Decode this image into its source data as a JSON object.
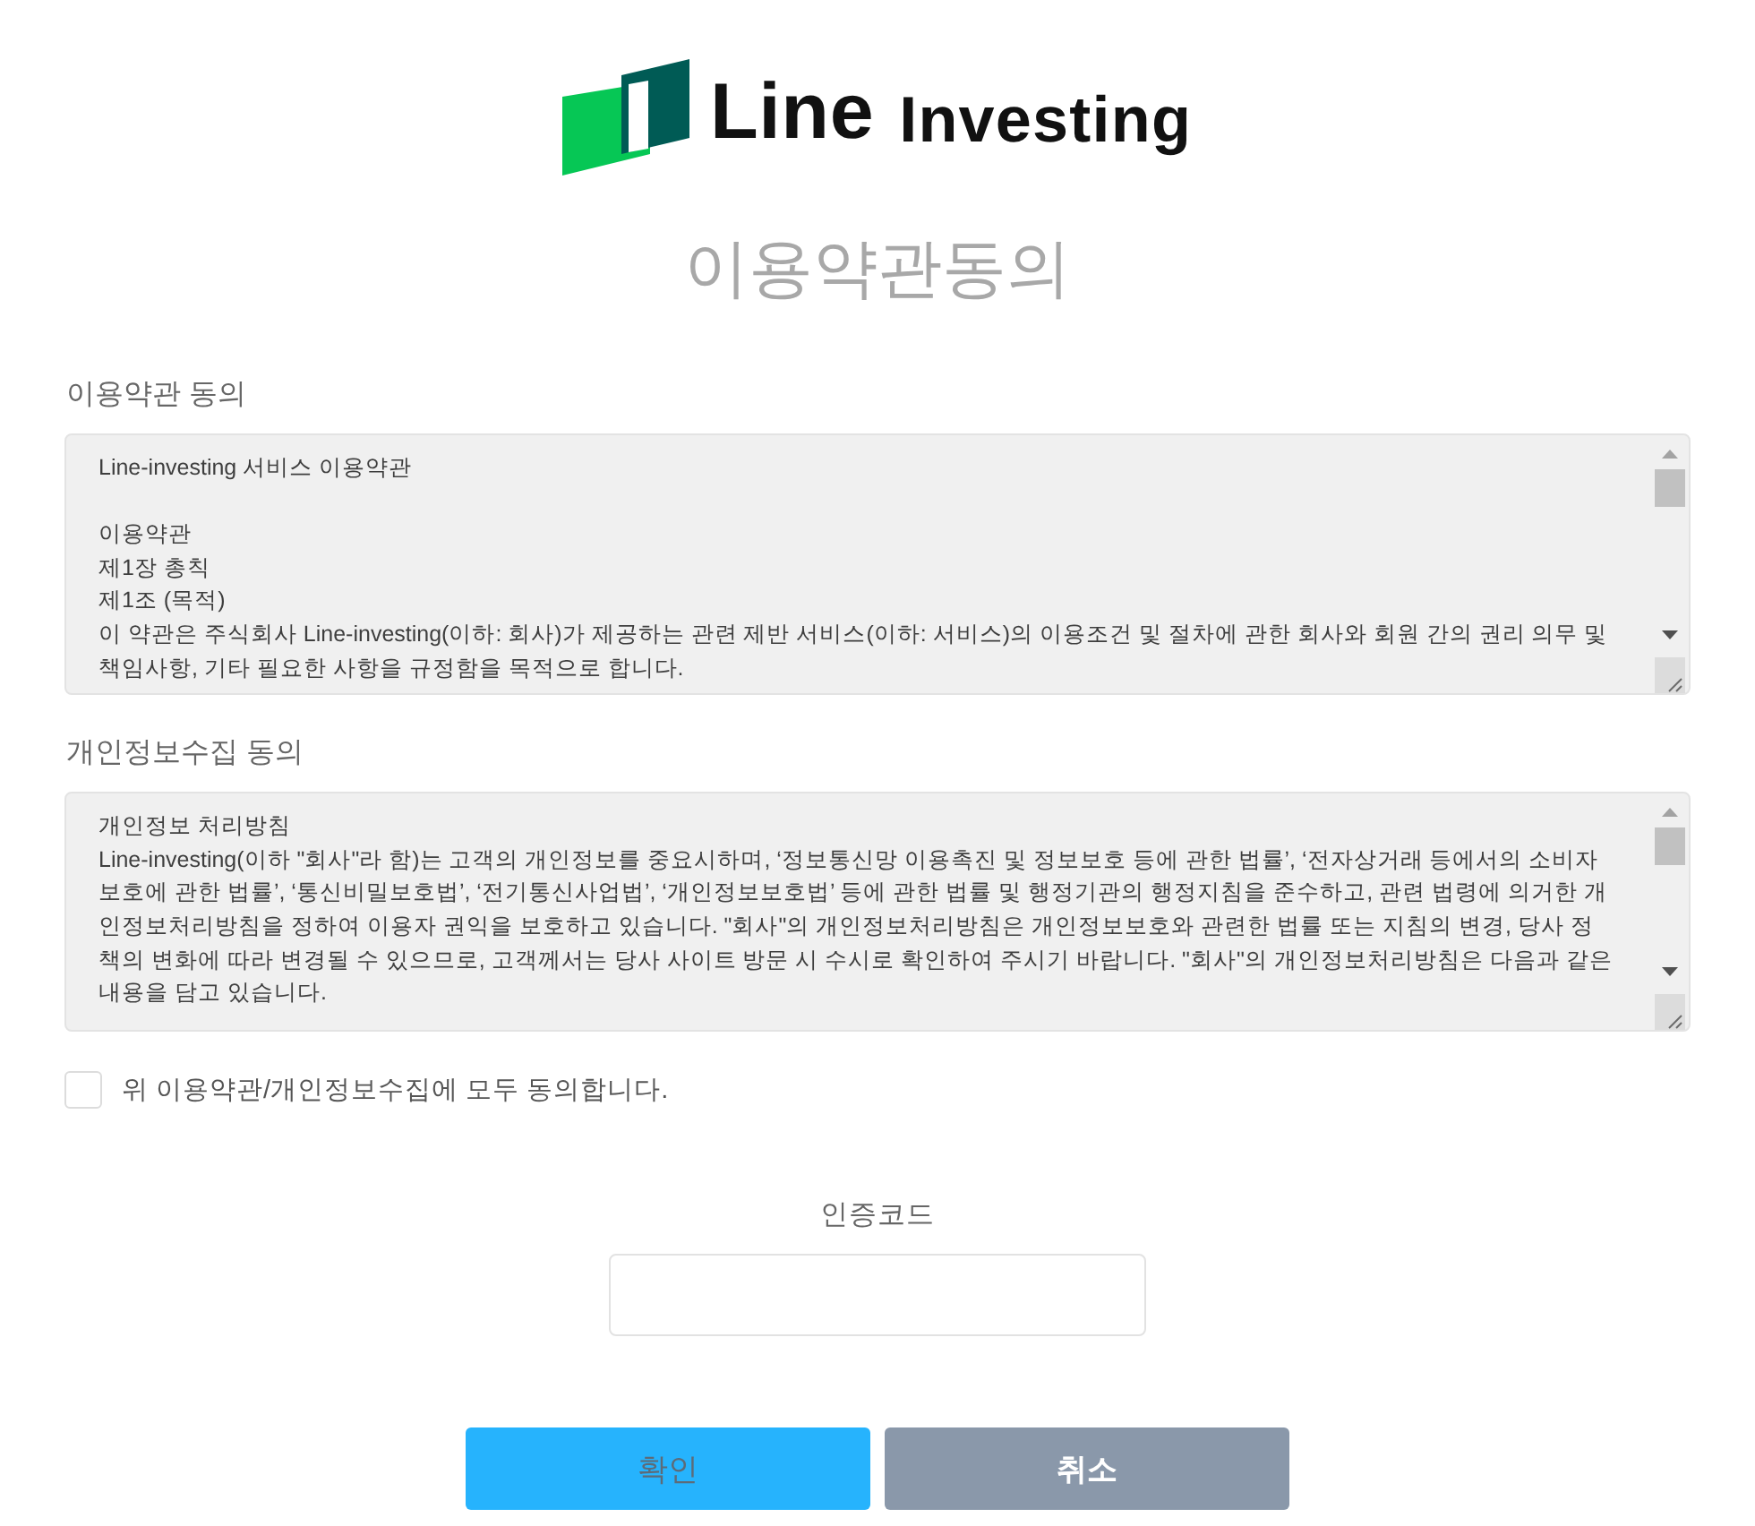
{
  "logo": {
    "brand": "Line",
    "suffix": "Investing"
  },
  "title": "이용약관동의",
  "agreements": [
    {
      "label": "이용약관 동의",
      "paragraph_groups": [
        {
          "lines": [
            "Line-investing 서비스 이용약관"
          ]
        },
        {
          "lines": [
            "이용약관",
            "제1장 총칙",
            "제1조 (목적)",
            "이 약관은 주식회사 Line-investing(이하: 회사)가 제공하는 관련 제반 서비스(이하: 서비스)의 이용조건 및 절차에 관한 회사와 회원 간의 권리 의무 및 책임사항, 기타 필요한 사항을 규정함을 목적으로 합니다."
          ]
        }
      ]
    },
    {
      "label": "개인정보수집 동의",
      "paragraph_groups": [
        {
          "lines": [
            "개인정보 처리방침",
            "Line-investing(이하 \"회사\"라 함)는 고객의 개인정보를 중요시하며, ‘정보통신망 이용촉진 및 정보보호 등에 관한 법률’, ‘전자상거래 등에서의 소비자보호에 관한 법률’, ‘통신비밀보호법’, ‘전기통신사업법’, ‘개인정보보호법’ 등에 관한 법률 및 행정기관의 행정지침을 준수하고, 관련 법령에 의거한 개인정보처리방침을 정하여 이용자 권익을 보호하고 있습니다. \"회사\"의 개인정보처리방침은 개인정보보호와 관련한 법률 또는 지침의 변경, 당사 정책의 변화에 따라 변경될 수 있으므로, 고객께서는 당사 사이트 방문 시 수시로 확인하여 주시기 바랍니다. \"회사\"의 개인정보처리방침은 다음과 같은 내용을 담고 있습니다."
          ]
        }
      ]
    }
  ],
  "agree_all": {
    "label": "위 이용약관/개인정보수집에 모두 동의합니다.",
    "checked": false
  },
  "auth_code": {
    "label": "인증코드"
  },
  "buttons": [
    {
      "label": "확인",
      "kind": "confirm"
    },
    {
      "label": "취소",
      "kind": "cancel"
    }
  ]
}
